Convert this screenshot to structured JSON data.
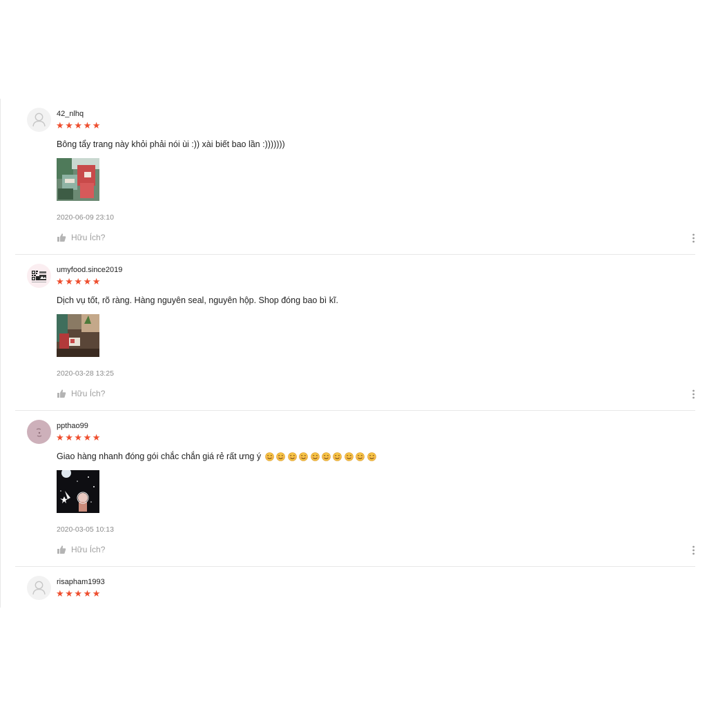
{
  "reviews": [
    {
      "username": "42_nlhq",
      "rating": 5,
      "avatar": "default-user-icon",
      "comment": "Bông tẩy trang này khỏi phải nói ùi :)) xài biết bao lần :)))))))",
      "date": "2020-06-09 23:10",
      "helpful_label": "Hữu Ích?"
    },
    {
      "username": "umyfood.since2019",
      "rating": 5,
      "avatar": "qr-code-avatar",
      "comment": "Dịch vụ tốt, rõ ràng. Hàng nguyên seal, nguyên hộp. Shop đóng bao bì kĩ.",
      "date": "2020-03-28 13:25",
      "helpful_label": "Hữu Ích?"
    },
    {
      "username": "ppthao99",
      "rating": 5,
      "avatar": "photo-avatar",
      "comment": "Giao hàng nhanh đóng gói chắc chắn giá rẻ rất ưng ý",
      "emoji_count": 10,
      "date": "2020-03-05 10:13",
      "helpful_label": "Hữu Ích?"
    },
    {
      "username": "risapham1993",
      "rating": 5,
      "avatar": "default-user-icon"
    }
  ],
  "colors": {
    "star": "#ee4d2d",
    "meta_text": "#8a8a8a",
    "divider": "#e8e8e8"
  }
}
